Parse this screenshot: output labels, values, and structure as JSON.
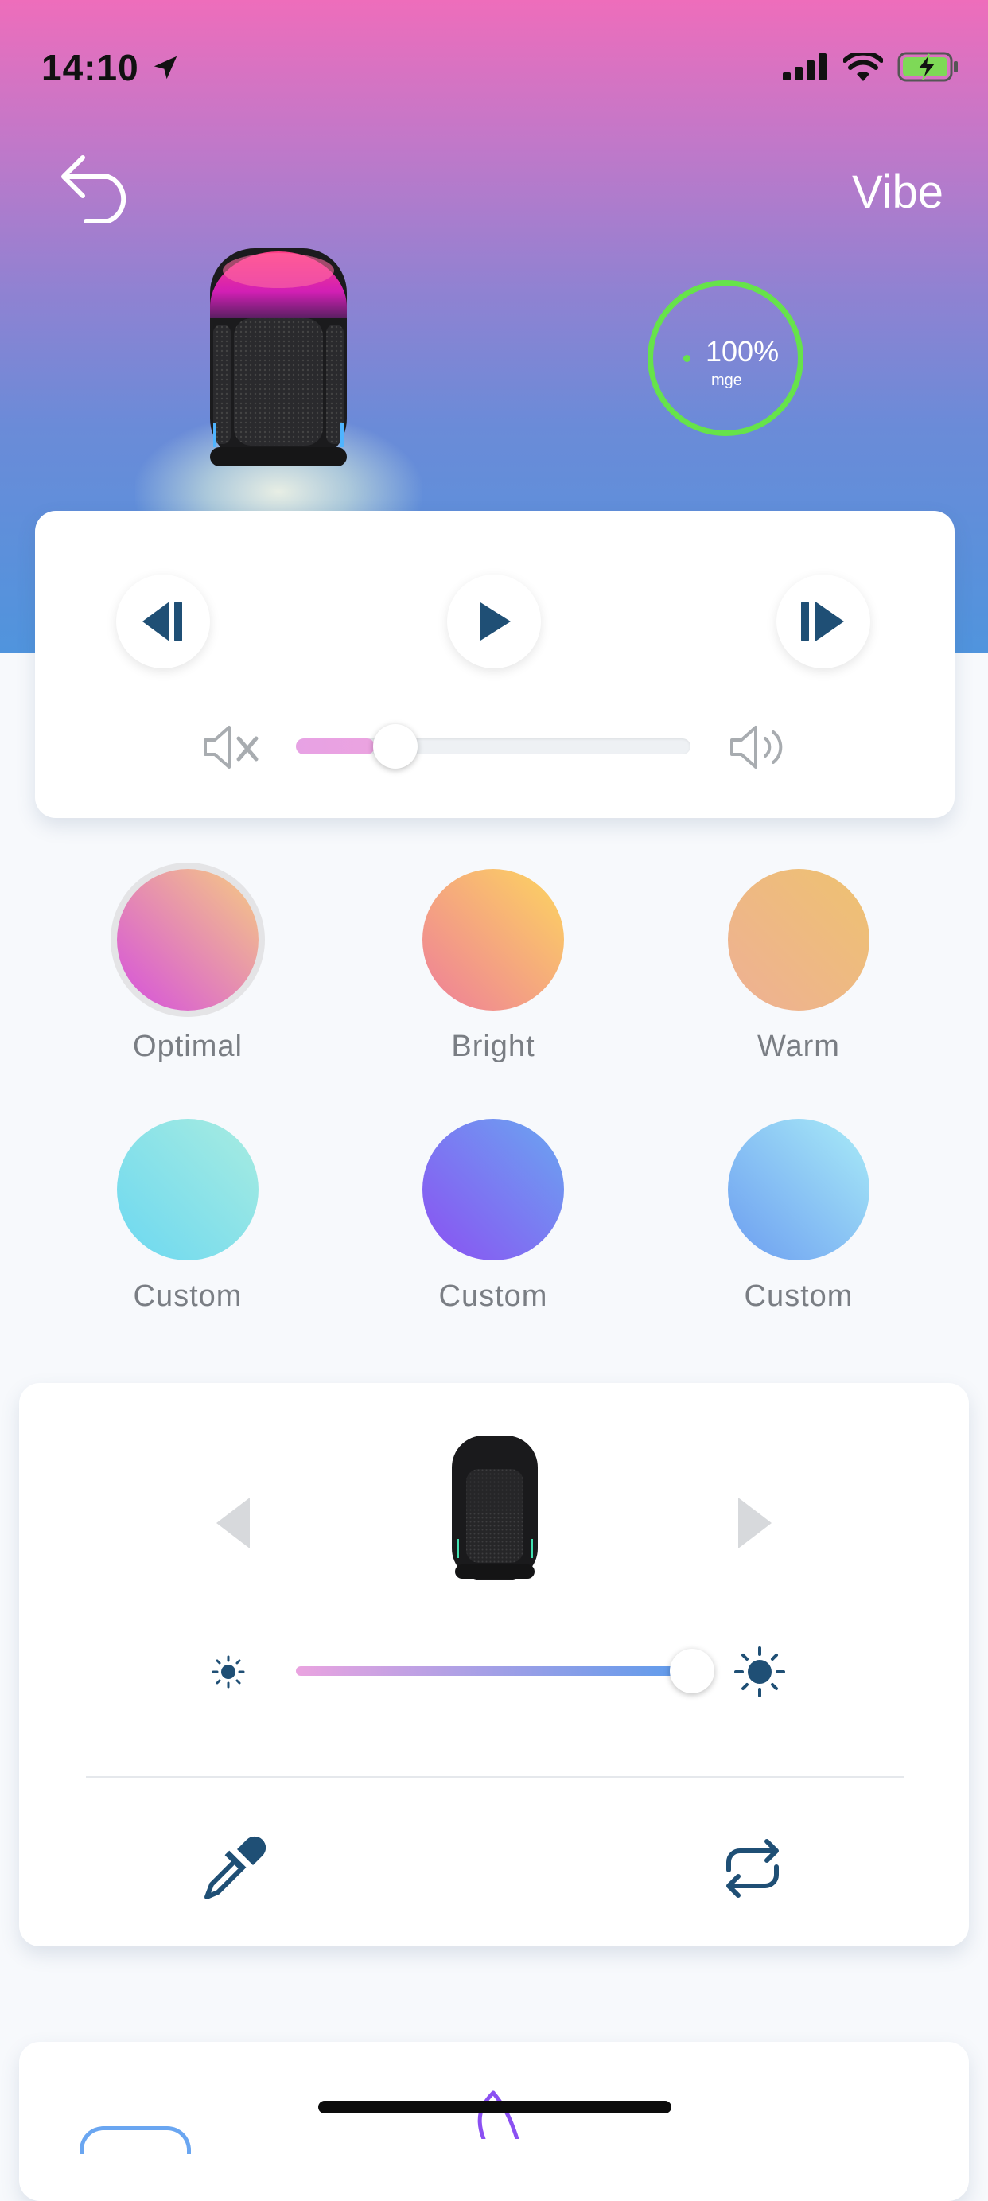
{
  "status_bar": {
    "time": "14:10"
  },
  "header": {
    "title": "Vibe",
    "back_icon": "back-arrow-icon"
  },
  "device": {
    "battery": {
      "percent_text": "100%",
      "sub_text": "mge",
      "ring_color": "#66e34a"
    }
  },
  "player": {
    "controls": [
      "skip-previous-icon",
      "play-icon",
      "skip-next-icon"
    ],
    "volume": {
      "level": 0.2,
      "mute_icon": "volume-mute-icon",
      "max_icon": "volume-up-icon"
    }
  },
  "presets": [
    {
      "label": "Optimal",
      "colors": [
        "#f6cc82",
        "#d54fde"
      ],
      "selected": true
    },
    {
      "label": "Bright",
      "colors": [
        "#fdd65f",
        "#ee7d9a"
      ],
      "selected": false
    },
    {
      "label": "Warm",
      "colors": [
        "#eec270",
        "#eeb095"
      ],
      "selected": false
    },
    {
      "label": "Custom",
      "colors": [
        "#a8ece0",
        "#6cd8f1"
      ],
      "selected": false
    },
    {
      "label": "Custom",
      "colors": [
        "#6aa6f1",
        "#8b50f2"
      ],
      "selected": false
    },
    {
      "label": "Custom",
      "colors": [
        "#a9ecf7",
        "#6c9df1"
      ],
      "selected": false
    }
  ],
  "light": {
    "brightness": 1.0,
    "prev_icon": "chevron-left-icon",
    "next_icon": "chevron-right-icon",
    "low_icon": "brightness-low-icon",
    "high_icon": "brightness-high-icon",
    "actions": [
      "eyedropper-icon",
      "repeat-icon"
    ]
  },
  "colors": {
    "accent": "#1f4f75"
  }
}
